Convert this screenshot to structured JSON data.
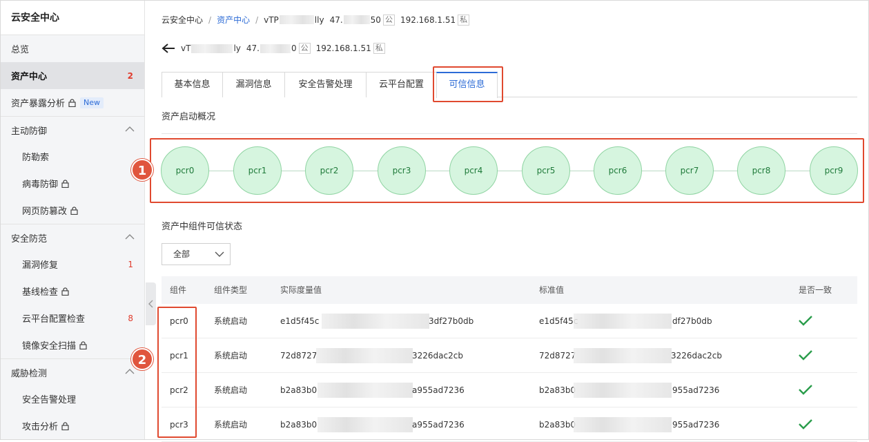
{
  "sidebar": {
    "title": "云安全中心",
    "items": [
      {
        "label": "总览"
      },
      {
        "label": "资产中心",
        "count": "2"
      },
      {
        "label": "资产暴露分析",
        "badge": "New"
      },
      {
        "label": "主动防御"
      },
      {
        "label": "防勒索"
      },
      {
        "label": "病毒防御"
      },
      {
        "label": "网页防篡改"
      },
      {
        "label": "安全防范"
      },
      {
        "label": "漏洞修复",
        "count": "1"
      },
      {
        "label": "基线检查"
      },
      {
        "label": "云平台配置检查",
        "count": "8"
      },
      {
        "label": "镜像安全扫描"
      },
      {
        "label": "威胁检测"
      },
      {
        "label": "安全告警处理"
      },
      {
        "label": "攻击分析"
      }
    ]
  },
  "breadcrumb": {
    "root": "云安全中心",
    "section": "资产中心",
    "asset_prefix": "vTP",
    "asset_suffix": "lly",
    "ip_public_prefix": "47.",
    "ip_public_suffix": "50",
    "public_tag": "公",
    "ip_private": "192.168.1.51",
    "private_tag": "私"
  },
  "title": {
    "asset_prefix": "vT",
    "asset_suffix": "ly",
    "ip_public_prefix": "47.",
    "ip_public_suffix": "0",
    "public_tag": "公",
    "ip_private": "192.168.1.51",
    "private_tag": "私"
  },
  "tabs": [
    {
      "label": "基本信息"
    },
    {
      "label": "漏洞信息"
    },
    {
      "label": "安全告警处理"
    },
    {
      "label": "云平台配置"
    },
    {
      "label": "可信信息",
      "active": true
    }
  ],
  "boot_overview": {
    "title": "资产启动概况",
    "nodes": [
      "pcr0",
      "pcr1",
      "pcr2",
      "pcr3",
      "pcr4",
      "pcr5",
      "pcr6",
      "pcr7",
      "pcr8",
      "pcr9"
    ]
  },
  "component_status": {
    "title": "资产中组件可信状态",
    "filter_value": "全部",
    "columns": [
      "组件",
      "组件类型",
      "实际度量值",
      "标准值",
      "是否一致"
    ],
    "rows": [
      {
        "component": "pcr0",
        "type": "系统启动",
        "actual_prefix": "e1d5f45c",
        "actual_suffix": "3df27b0db",
        "standard_prefix": "e1d5f45c",
        "standard_suffix": "df27b0db"
      },
      {
        "component": "pcr1",
        "type": "系统启动",
        "actual_prefix": "72d8727",
        "actual_suffix": "3226dac2cb",
        "standard_prefix": "72d8727",
        "standard_suffix": "3226dac2cb"
      },
      {
        "component": "pcr2",
        "type": "系统启动",
        "actual_prefix": "b2a83b0",
        "actual_suffix": "a955ad7236",
        "standard_prefix": "b2a83b0",
        "standard_suffix": "955ad7236"
      },
      {
        "component": "pcr3",
        "type": "系统启动",
        "actual_prefix": "b2a83b0",
        "actual_suffix": "a955ad7236",
        "standard_prefix": "b2a83b0",
        "standard_suffix": "955ad7236"
      }
    ]
  },
  "callouts": [
    "1",
    "2"
  ],
  "colors": {
    "accent": "#2c6bd6",
    "highlight": "#e0492f",
    "node_fill": "#d6f5df",
    "check": "#2a9d4b"
  }
}
